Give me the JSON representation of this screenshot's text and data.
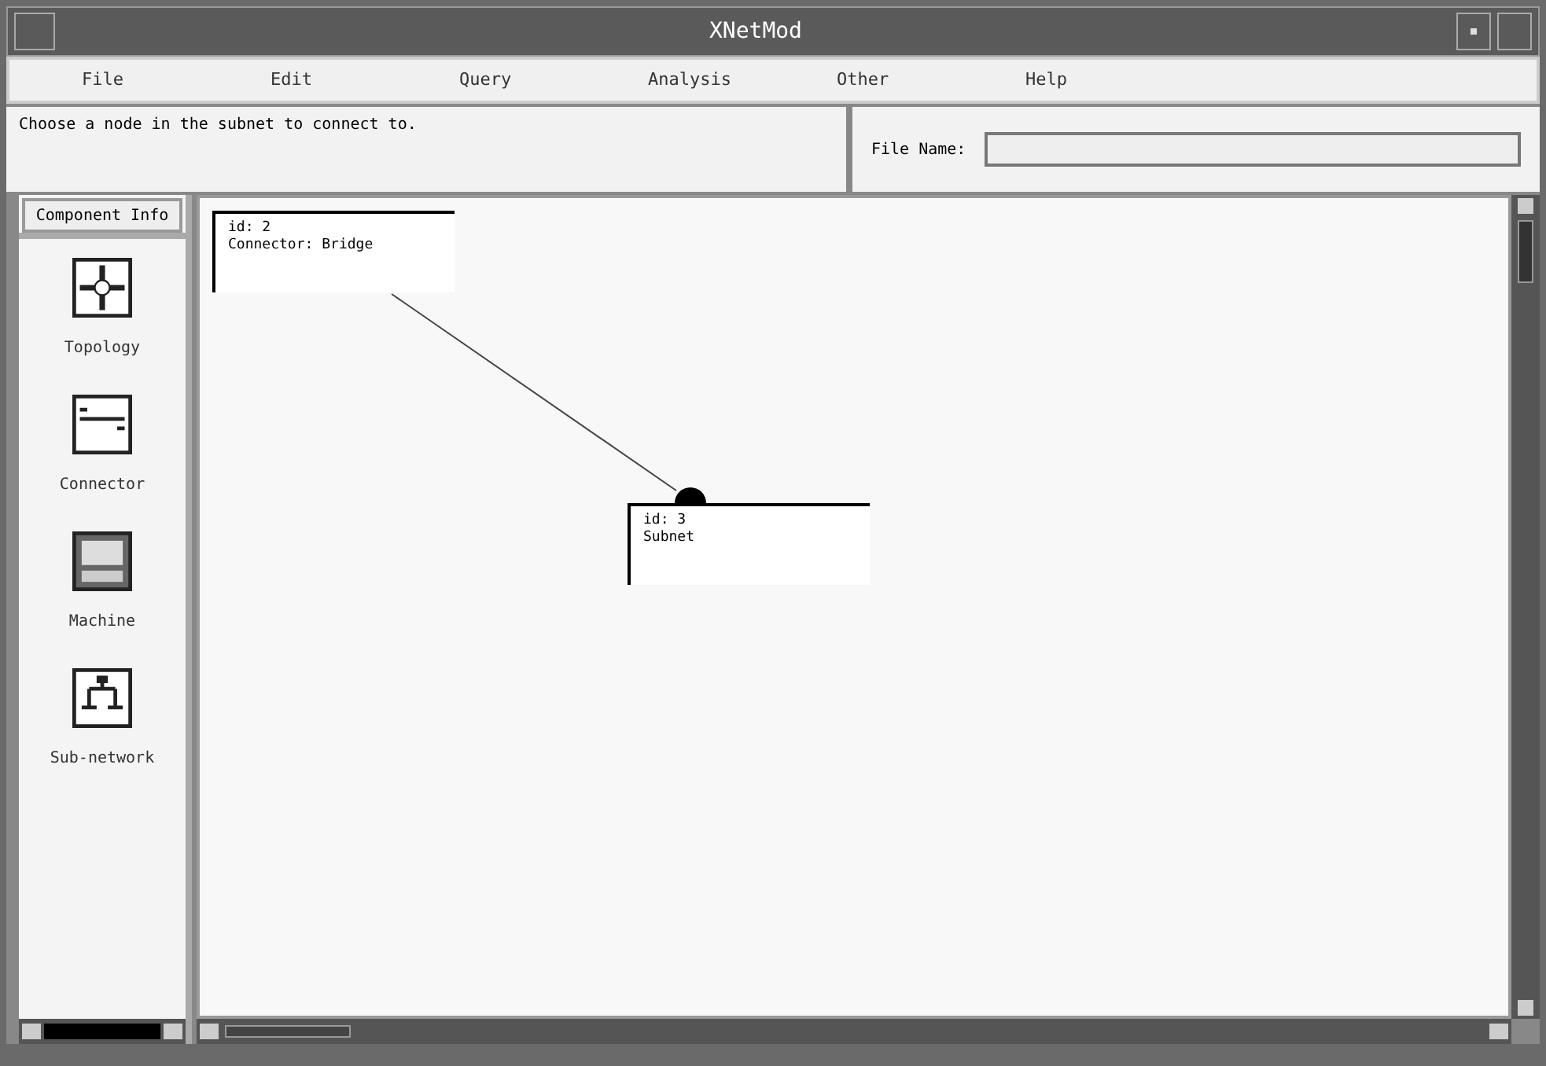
{
  "window": {
    "title": "XNetMod"
  },
  "menu": [
    "File",
    "Edit",
    "Query",
    "Analysis",
    "Other",
    "Help"
  ],
  "message": "Choose a node in the subnet to connect to.",
  "file_name": {
    "label": "File Name:"
  },
  "palette": {
    "button": "Component Info",
    "items": [
      {
        "kind": "topology",
        "label": "Topology"
      },
      {
        "kind": "connector",
        "label": "Connector"
      },
      {
        "kind": "machine",
        "label": "Machine"
      },
      {
        "kind": "subnetwork",
        "label": "Sub-network"
      }
    ]
  },
  "canvas": {
    "nodes": [
      {
        "lines": [
          "id: 2",
          "Connector: Bridge"
        ]
      },
      {
        "lines": [
          "id: 3",
          "Subnet"
        ]
      }
    ]
  }
}
